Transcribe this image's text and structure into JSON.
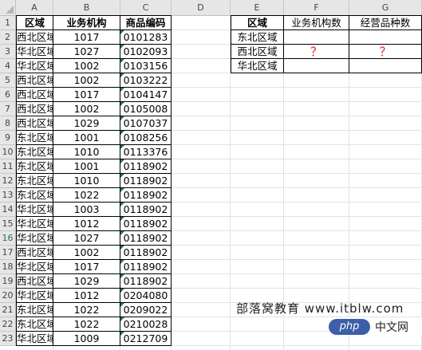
{
  "columns": [
    "A",
    "B",
    "C",
    "D",
    "E",
    "F",
    "G"
  ],
  "rows": [
    "1",
    "2",
    "3",
    "4",
    "5",
    "6",
    "7",
    "8",
    "9",
    "10",
    "11",
    "12",
    "13",
    "14",
    "15",
    "16",
    "17",
    "18",
    "19",
    "20",
    "21",
    "22",
    "23"
  ],
  "left_table": {
    "headers": [
      "区域",
      "业务机构",
      "商品编码"
    ],
    "data": [
      [
        "西北区域",
        "1017",
        "0101283"
      ],
      [
        "华北区域",
        "1027",
        "0102093"
      ],
      [
        "华北区域",
        "1002",
        "0103156"
      ],
      [
        "西北区域",
        "1002",
        "0103222"
      ],
      [
        "西北区域",
        "1017",
        "0104147"
      ],
      [
        "西北区域",
        "1002",
        "0105008"
      ],
      [
        "西北区域",
        "1029",
        "0107037"
      ],
      [
        "东北区域",
        "1001",
        "0108256"
      ],
      [
        "东北区域",
        "1010",
        "0113376"
      ],
      [
        "东北区域",
        "1001",
        "0118902"
      ],
      [
        "东北区域",
        "1010",
        "0118902"
      ],
      [
        "东北区域",
        "1022",
        "0118902"
      ],
      [
        "华北区域",
        "1003",
        "0118902"
      ],
      [
        "华北区域",
        "1012",
        "0118902"
      ],
      [
        "华北区域",
        "1027",
        "0118902"
      ],
      [
        "西北区域",
        "1002",
        "0118902"
      ],
      [
        "华北区域",
        "1017",
        "0118902"
      ],
      [
        "西北区域",
        "1029",
        "0118902"
      ],
      [
        "华北区域",
        "1012",
        "0204080"
      ],
      [
        "东北区域",
        "1022",
        "0209022"
      ],
      [
        "东北区域",
        "1022",
        "0210028"
      ],
      [
        "华北区域",
        "1009",
        "0212709"
      ]
    ]
  },
  "right_table": {
    "headers": [
      "区域",
      "业务机构数",
      "经营品种数"
    ],
    "rows": [
      [
        "东北区域",
        "",
        ""
      ],
      [
        "西北区域",
        "？",
        "？"
      ],
      [
        "华北区域",
        "",
        ""
      ]
    ]
  },
  "watermark": "部落窝教育 www.itblw.com",
  "badge": {
    "logo": "php",
    "text": "中文网"
  },
  "colors": {
    "header_bg": "#e6e6e6",
    "question": "#e02020",
    "error_triangle": "#1f7a3a"
  }
}
